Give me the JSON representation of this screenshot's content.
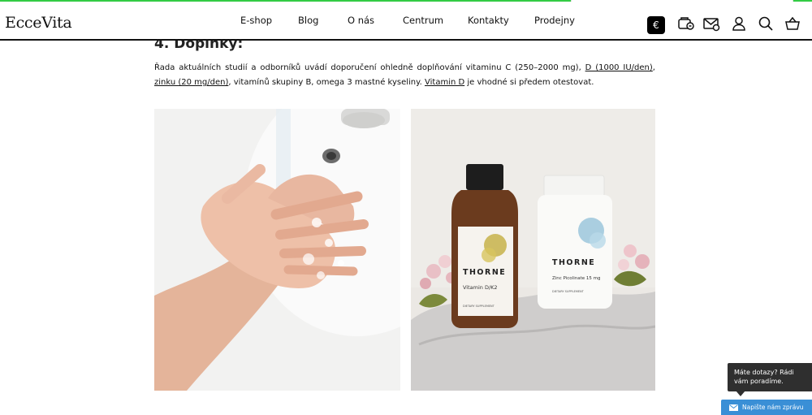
{
  "header": {
    "logo": "EcceVita",
    "nav": [
      {
        "id": "eshop",
        "label": "E-shop"
      },
      {
        "id": "blog",
        "label": "Blog"
      },
      {
        "id": "about",
        "label": "O nás"
      },
      {
        "id": "center",
        "label": "Centrum"
      },
      {
        "id": "contacts",
        "label": "Kontakty"
      },
      {
        "id": "stores",
        "label": "Prodejny"
      }
    ],
    "currency": "€",
    "icons": [
      "voucher-icon",
      "mail-icon",
      "user-icon",
      "search-icon",
      "cart-icon"
    ]
  },
  "article": {
    "heading": "4. Doplňky:",
    "paragraph": {
      "t1": "Řada aktuálních studií a odborníků uvádí doporučení ohledně doplňování vitaminu C (250–2000 mg), ",
      "link_d": "D (1000 IU/den)",
      "t2": ", ",
      "link_zinc": "zinku (20 mg/den)",
      "t3": ", vitamínů skupiny B, omega 3 mastné kyseliny. ",
      "link_vitd": "Vitamin D",
      "t4": " je vhodné si předem otestovat."
    }
  },
  "photos": {
    "bottle_brand": "THORNE",
    "bottle_left_label": "Vitamin D/K2",
    "bottle_right_label": "Zinc Picolinate 15 mg",
    "supplement_text": "DIETARY SUPPLEMENT"
  },
  "chat": {
    "bubble_line1": "Máte dotazy? Rádi",
    "bubble_line2": "vám poradíme.",
    "button_label": "Napište nám zprávu"
  },
  "colors": {
    "topline": "#33cc44",
    "chat_button": "#3a8fd6",
    "chat_bubble": "#2f2f2f"
  }
}
